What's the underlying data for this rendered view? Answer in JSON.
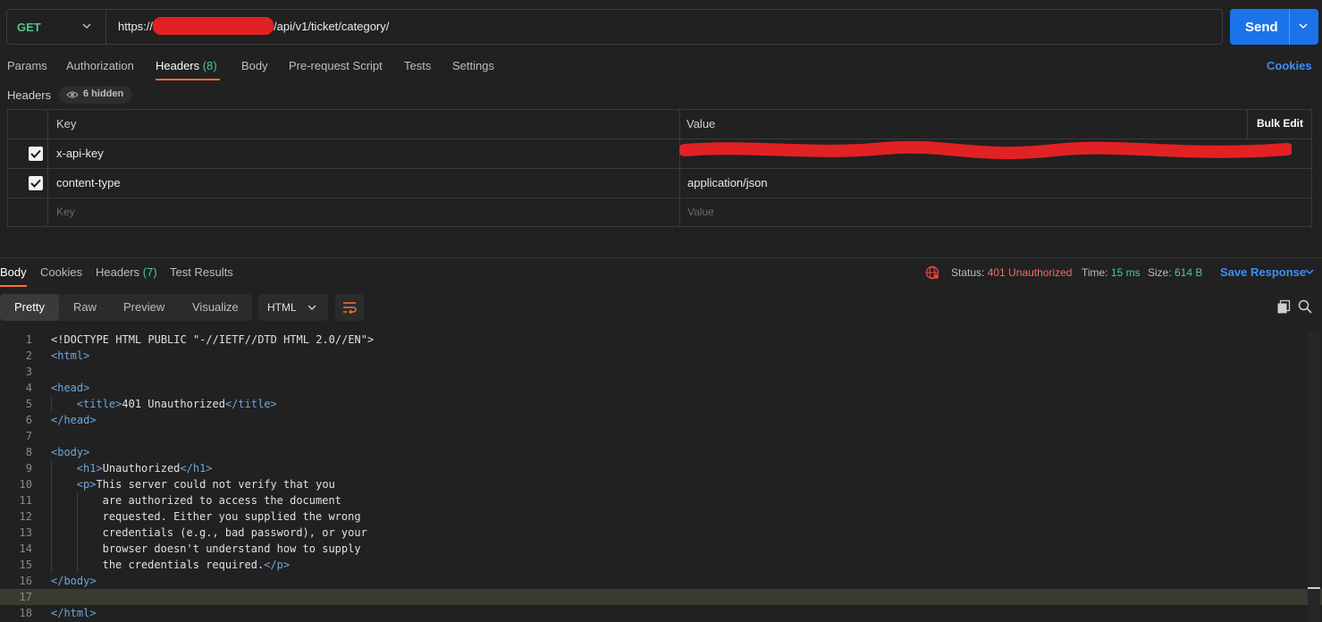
{
  "request": {
    "method": "GET",
    "url_prefix": "https://",
    "url_suffix": "/api/v1/ticket/category/",
    "send_label": "Send"
  },
  "request_tabs": [
    {
      "label": "Params"
    },
    {
      "label": "Authorization"
    },
    {
      "label": "Headers",
      "count": "(8)"
    },
    {
      "label": "Body"
    },
    {
      "label": "Pre-request Script"
    },
    {
      "label": "Tests"
    },
    {
      "label": "Settings"
    }
  ],
  "cookies_link": "Cookies",
  "headers_section": {
    "label": "Headers",
    "hidden_count": "6 hidden",
    "columns": {
      "key": "Key",
      "value": "Value",
      "bulk_edit": "Bulk Edit"
    },
    "rows": [
      {
        "key": "x-api-key",
        "value": "",
        "checked": true
      },
      {
        "key": "content-type",
        "value": "application/json",
        "checked": true
      }
    ],
    "placeholder": {
      "key": "Key",
      "value": "Value"
    }
  },
  "response_tabs": [
    {
      "label": "Body"
    },
    {
      "label": "Cookies"
    },
    {
      "label": "Headers",
      "count": "(7)"
    },
    {
      "label": "Test Results"
    }
  ],
  "response_meta": {
    "status_label": "Status:",
    "status_value": "401 Unauthorized",
    "time_label": "Time:",
    "time_value": "15 ms",
    "size_label": "Size:",
    "size_value": "614 B",
    "save_label": "Save Response"
  },
  "view_modes": [
    "Pretty",
    "Raw",
    "Preview",
    "Visualize"
  ],
  "format": "HTML",
  "code_lines": [
    {
      "n": "1",
      "indent": 0,
      "parts": [
        [
          "t",
          "<!DOCTYPE HTML PUBLIC \"-//IETF//DTD HTML 2.0//EN\">"
        ]
      ]
    },
    {
      "n": "2",
      "indent": 0,
      "parts": [
        [
          "g",
          "<html>"
        ]
      ]
    },
    {
      "n": "3",
      "indent": 0,
      "parts": []
    },
    {
      "n": "4",
      "indent": 0,
      "parts": [
        [
          "g",
          "<head>"
        ]
      ]
    },
    {
      "n": "5",
      "indent": 1,
      "parts": [
        [
          "g",
          "<title>"
        ],
        [
          "t",
          "401 Unauthorized"
        ],
        [
          "g",
          "</title>"
        ]
      ]
    },
    {
      "n": "6",
      "indent": 0,
      "parts": [
        [
          "g",
          "</head>"
        ]
      ]
    },
    {
      "n": "7",
      "indent": 0,
      "parts": []
    },
    {
      "n": "8",
      "indent": 0,
      "parts": [
        [
          "g",
          "<body>"
        ]
      ]
    },
    {
      "n": "9",
      "indent": 1,
      "parts": [
        [
          "g",
          "<h1>"
        ],
        [
          "t",
          "Unauthorized"
        ],
        [
          "g",
          "</h1>"
        ]
      ]
    },
    {
      "n": "10",
      "indent": 1,
      "parts": [
        [
          "g",
          "<p>"
        ],
        [
          "t",
          "This server could not verify that you"
        ]
      ]
    },
    {
      "n": "11",
      "indent": 2,
      "parts": [
        [
          "t",
          "are authorized to access the document"
        ]
      ]
    },
    {
      "n": "12",
      "indent": 2,
      "parts": [
        [
          "t",
          "requested. Either you supplied the wrong"
        ]
      ]
    },
    {
      "n": "13",
      "indent": 2,
      "parts": [
        [
          "t",
          "credentials (e.g., bad password), or your"
        ]
      ]
    },
    {
      "n": "14",
      "indent": 2,
      "parts": [
        [
          "t",
          "browser doesn't understand how to supply"
        ]
      ]
    },
    {
      "n": "15",
      "indent": 2,
      "parts": [
        [
          "t",
          "the credentials required."
        ],
        [
          "g",
          "</p>"
        ]
      ]
    },
    {
      "n": "16",
      "indent": 0,
      "parts": [
        [
          "g",
          "</body>"
        ]
      ]
    },
    {
      "n": "17",
      "indent": 0,
      "parts": [],
      "highlight": true
    },
    {
      "n": "18",
      "indent": 0,
      "parts": [
        [
          "g",
          "</html>"
        ]
      ]
    }
  ],
  "colors": {
    "accent_tab": "#ff6c37",
    "send_button": "#1a73e8",
    "method_get": "#4ec990",
    "status_error": "#f26b6b",
    "redaction": "#e22124"
  }
}
